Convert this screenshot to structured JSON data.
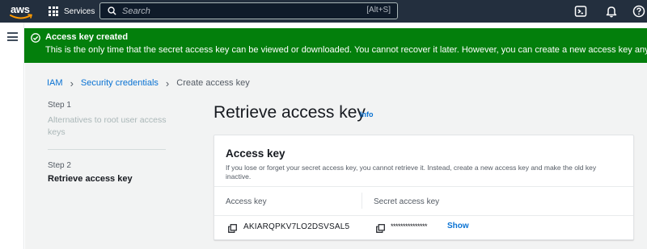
{
  "nav": {
    "logo_text": "aws",
    "services_label": "Services",
    "search_placeholder": "Search",
    "search_shortcut": "[Alt+S]",
    "icons": [
      "cloudshell-icon",
      "bell-icon",
      "help-icon"
    ],
    "bg_color": "#232f3e"
  },
  "flash": {
    "title": "Access key created",
    "message": "This is the only time that the secret access key can be viewed or downloaded. You cannot recover it later. However, you can create a new access key any time.",
    "color": "#037f0c"
  },
  "breadcrumb": {
    "items": [
      "IAM",
      "Security credentials"
    ],
    "current": "Create access key"
  },
  "steps": {
    "step1_label": "Step 1",
    "step1_title": "Alternatives to root user access keys",
    "step2_label": "Step 2",
    "step2_title": "Retrieve access key"
  },
  "page": {
    "title": "Retrieve access key",
    "info_label": "Info"
  },
  "panel": {
    "title": "Access key",
    "description": "If you lose or forget your secret access key, you cannot retrieve it. Instead, create a new access key and make the old key inactive.",
    "columns": [
      "Access key",
      "Secret access key"
    ],
    "access_key_value": "AKIARQPKV7LO2DSVSAL5",
    "secret_mask": "***************",
    "show_label": "Show"
  },
  "accent_color": "#0972d3"
}
